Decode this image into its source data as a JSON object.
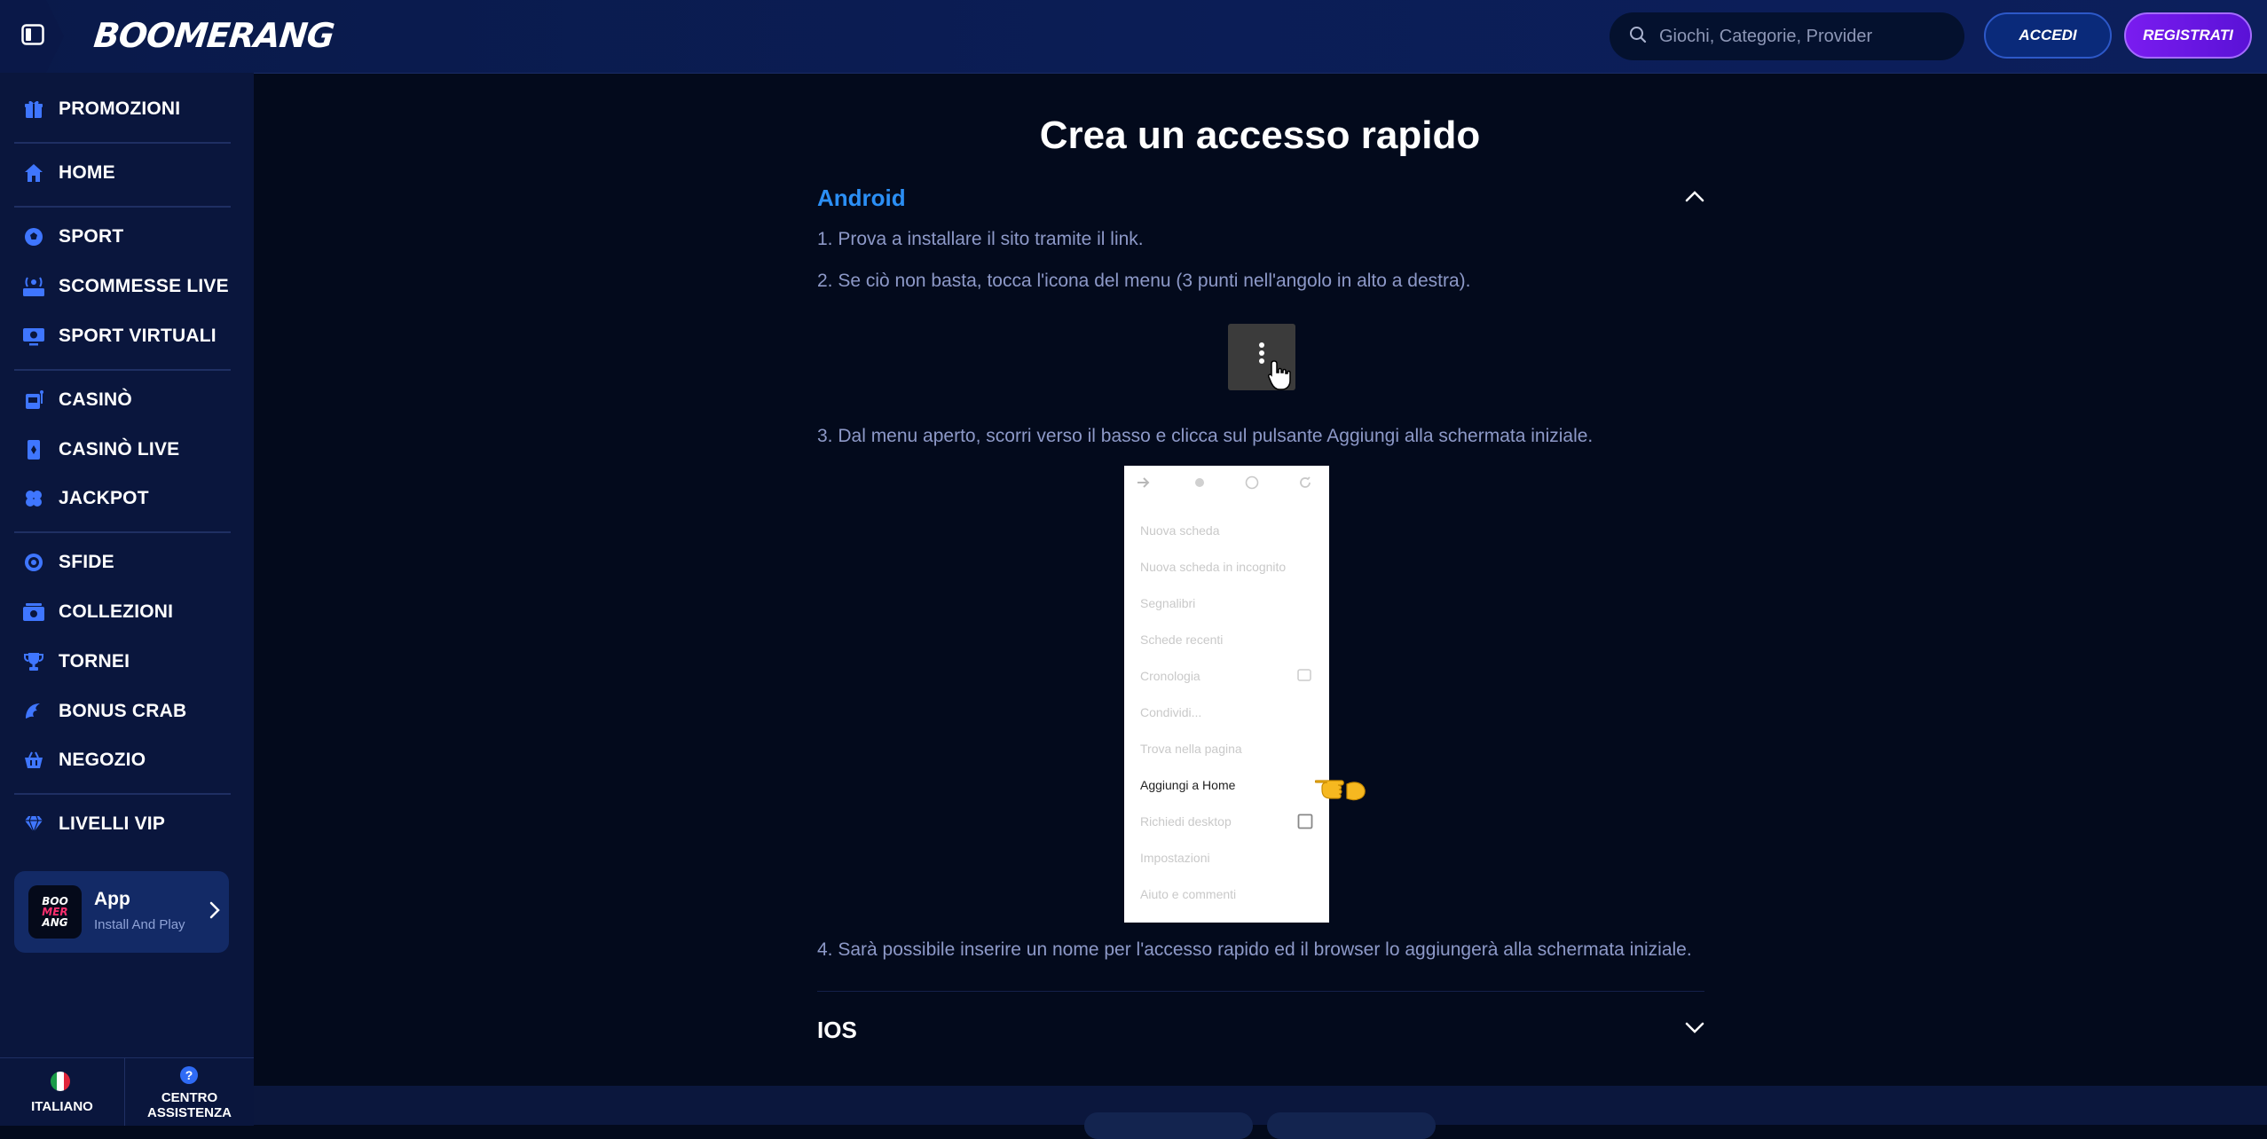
{
  "header": {
    "logo_text": "BOOMERANG",
    "search_placeholder": "Giochi, Categorie, Provider",
    "login_label": "ACCEDI",
    "register_label": "REGISTRATI"
  },
  "sidebar": {
    "items": [
      {
        "label": "PROMOZIONI",
        "icon": "gift-icon"
      },
      {
        "label": "HOME",
        "icon": "home-icon"
      },
      {
        "label": "SPORT",
        "icon": "soccer-ball-icon"
      },
      {
        "label": "SCOMMESSE LIVE",
        "icon": "live-icon"
      },
      {
        "label": "SPORT VIRTUALI",
        "icon": "monitor-icon"
      },
      {
        "label": "CASINÒ",
        "icon": "slot-machine-icon"
      },
      {
        "label": "CASINÒ LIVE",
        "icon": "card-icon"
      },
      {
        "label": "JACKPOT",
        "icon": "clover-icon"
      },
      {
        "label": "SFIDE",
        "icon": "target-icon"
      },
      {
        "label": "COLLEZIONI",
        "icon": "collection-icon"
      },
      {
        "label": "TORNEI",
        "icon": "trophy-icon"
      },
      {
        "label": "BONUS CRAB",
        "icon": "crab-claw-icon"
      },
      {
        "label": "NEGOZIO",
        "icon": "basket-icon"
      },
      {
        "label": "LIVELLI VIP",
        "icon": "diamond-icon"
      }
    ],
    "app_card": {
      "logo_lines": [
        "BOO",
        "MER",
        "ANG"
      ],
      "title": "App",
      "subtitle": "Install And Play"
    },
    "footer": {
      "language_label": "ITALIANO",
      "support_label_line1": "CENTRO",
      "support_label_line2": "ASSISTENZA"
    }
  },
  "main": {
    "title": "Crea un accesso rapido",
    "android": {
      "title": "Android",
      "steps": [
        "1. Prova a installare il sito tramite il link.",
        "2. Se ciò non basta, tocca l'icona del menu (3 punti nell'angolo in alto a destra).",
        "3. Dal menu aperto, scorri verso il basso e clicca sul pulsante Aggiungi alla schermata iniziale.",
        "4. Sarà possibile inserire un nome per l'accesso rapido ed il browser lo aggiungerà alla schermata iniziale."
      ],
      "menu_image_items": [
        "Nuova scheda",
        "Nuova scheda in incognito",
        "Segnalibri",
        "Schede recenti",
        "Cronologia",
        "Condividi...",
        "Trova nella pagina",
        "Aggiungi a Home",
        "Richiedi desktop",
        "Impostazioni",
        "Aiuto e commenti"
      ]
    },
    "ios": {
      "title": "IOS"
    }
  },
  "colors": {
    "background": "#030a1c",
    "sidebar": "#0a163d",
    "accent_blue": "#2b8ff5",
    "register_purple": "#7a1cf0",
    "step_text": "#8d99c8"
  }
}
